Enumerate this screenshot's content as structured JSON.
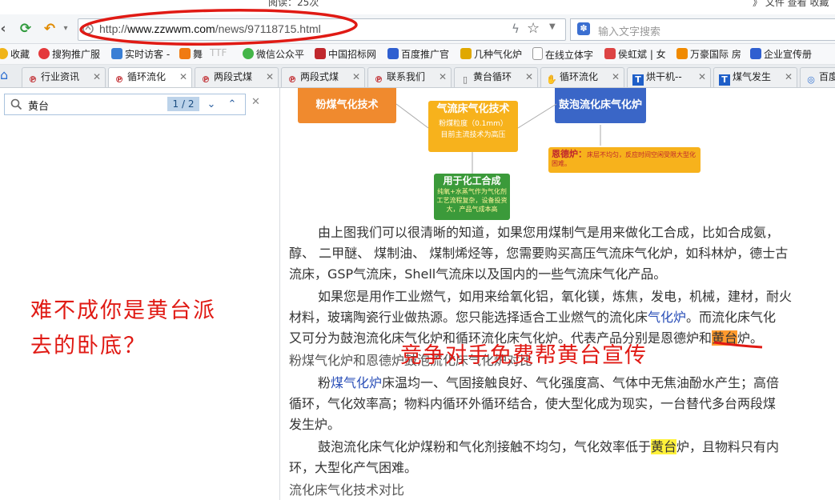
{
  "topbar": {
    "cut_text": "阅读：25次",
    "cut_right": "》 文件  查看  收藏"
  },
  "address": {
    "url_prefix": "http://",
    "url_domain": "www.zzwwm.com",
    "url_path": "/news/97118715.html"
  },
  "search": {
    "placeholder": "输入文字搜索"
  },
  "bookmarks": [
    {
      "label": "收藏",
      "color": "#f0b419"
    },
    {
      "label": "搜狗推广服",
      "color": "#e4393c"
    },
    {
      "label": "实时访客 -",
      "color": "#3a7fd5"
    },
    {
      "label": "舞",
      "color": "#f07a12"
    },
    {
      "label": "TTF",
      "color": "#999999"
    },
    {
      "label": "微信公众平",
      "color": "#44b549"
    },
    {
      "label": "中国招标网",
      "color": "#c0282d"
    },
    {
      "label": "百度推广官",
      "color": "#2f5fd0"
    },
    {
      "label": "几种气化炉",
      "color": "#e0a800"
    },
    {
      "label": "在线立体字",
      "color": "#888888"
    },
    {
      "label": "侯虹斌 | 女",
      "color": "#d44"
    },
    {
      "label": "万豪国际 房",
      "color": "#f08a00"
    },
    {
      "label": "企业宣传册",
      "color": "#2f5fd0"
    }
  ],
  "tabs": [
    {
      "label": "行业资讯",
      "active": false
    },
    {
      "label": "循环流化",
      "active": true
    },
    {
      "label": "两段式煤",
      "active": false
    },
    {
      "label": "两段式煤",
      "active": false
    },
    {
      "label": "联系我们",
      "active": false
    },
    {
      "label": "黄台循环",
      "active": false
    },
    {
      "label": "循环流化",
      "active": false
    },
    {
      "label": "烘干机--",
      "active": false
    },
    {
      "label": "煤气发生",
      "active": false
    },
    {
      "label": "百度",
      "active": false
    }
  ],
  "find": {
    "query": "黄台",
    "count": "1 / 2"
  },
  "annotations": {
    "left_line1": "难不成你是黄台派",
    "left_line2": "去的卧底？",
    "center": "竞争对手免费帮黄台宣传"
  },
  "diagram": {
    "pulverized": "粉煤气化技术",
    "cfb_title": "气流床气化技术",
    "cfb_l1": "粉煤粒度（0.1mm）",
    "cfb_l2": "目前主流技术为高压",
    "bubbling": "鼓泡流化床气化炉",
    "endel_title": "恩德炉：",
    "endel_text": "床层不均匀，反应时间空闲受限大型化困难。",
    "chem_title": "用于化工合成",
    "chem_text": "纯氧+水蒸气作为气化剂工艺流程复杂，设备投资大，产品气成本高"
  },
  "paragraphs": {
    "p1a": "由上图我们可以很清晰的知道，如果您用煤制气是用来做化工合成，比如合成氨，",
    "p1b": "醇、 二甲醚、 煤制油、 煤制烯烃等，您需要购买高压气流床气化炉，如科林炉，德士古",
    "p1c": "流床，GSP气流床，Shell气流床以及国内的一些气流床气化产品。",
    "p2a": "如果您是用作工业燃气，如用来给氧化铝，氧化镁，炼焦，发电，机械，建材，耐火",
    "p2b_pre": "材料，玻璃陶瓷行业做热源。您只能选择适合工业燃气的流化床",
    "p2b_link": "气化炉",
    "p2b_post": "。而流化床气化",
    "p2c_pre": "又可分为鼓泡流化床气化炉和循环流化床气化炉。代表产品分别是恩德炉和",
    "p2c_hl": "黄台",
    "p2c_post": "炉。",
    "p2d": "粉煤气化炉和恩德炉鼓泡流化床气化炉对比",
    "p3a_pre": "粉",
    "p3a_link": "煤气化炉",
    "p3a_post": "床温均一、气固接触良好、气化强度高、气体中无焦油酚水产生；高倍",
    "p3b": "循环，气化效率高；物料内循环外循环结合，使大型化成为现实，一台替代多台两段煤",
    "p3c": "发生炉。",
    "p4a_pre": "鼓泡流化床气化炉煤粉和气化剂接触不均匀，气化效率低于",
    "p4a_hl": "黄台",
    "p4a_post": "炉，且物料只有内",
    "p4b": "环，大型化产气困难。",
    "p5": "流化床气化技术对比"
  }
}
